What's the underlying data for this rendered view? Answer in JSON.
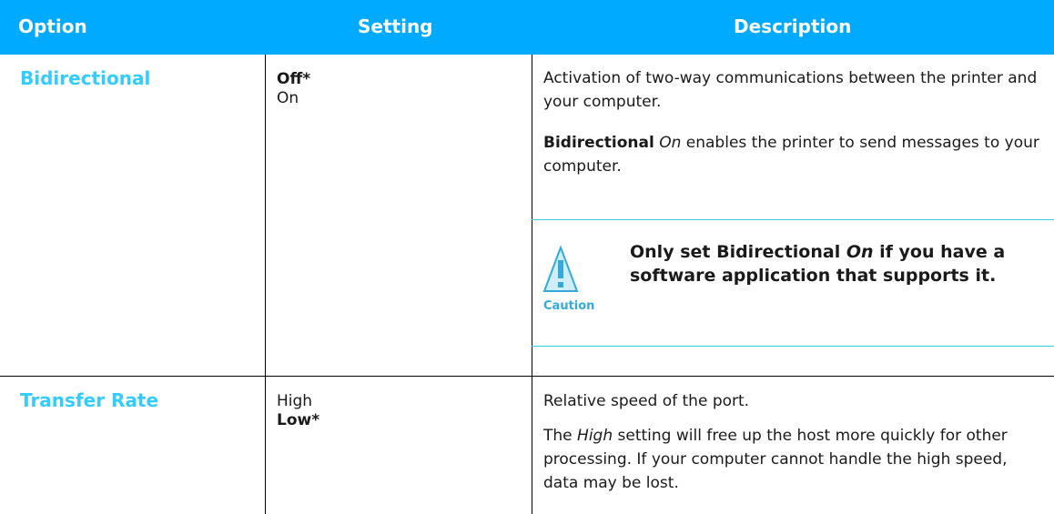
{
  "header": {
    "option": "Option",
    "setting": "Setting",
    "description": "Description"
  },
  "rows": [
    {
      "option": "Bidirectional",
      "settings": [
        "Off*",
        "On"
      ],
      "desc1": "Activation of two-way communications between the printer and your computer.",
      "desc2_bold": "Bidirectional",
      "desc2_italic": "On",
      "desc2_rest": " enables the printer to send messages to your computer.",
      "caution": {
        "label": "Caution",
        "icon": "warning-triangle-icon",
        "text_pre": "Only set Bidirectional ",
        "text_italic": "On",
        "text_post": " if you have a software application that supports it."
      }
    },
    {
      "option": "Transfer Rate",
      "settings": [
        "High",
        "Low*"
      ],
      "desc1": "Relative speed of the port.",
      "desc2_pre": "The ",
      "desc2_italic": "High",
      "desc2_rest": " setting will free up the host more quickly for other processing. If your computer cannot handle the high speed, data may be lost."
    }
  ],
  "colors": {
    "header_bg": "#00aaff",
    "option_text": "#33ccff",
    "caution_accent": "#33aadd",
    "divider_cyan": "#33ccee"
  }
}
